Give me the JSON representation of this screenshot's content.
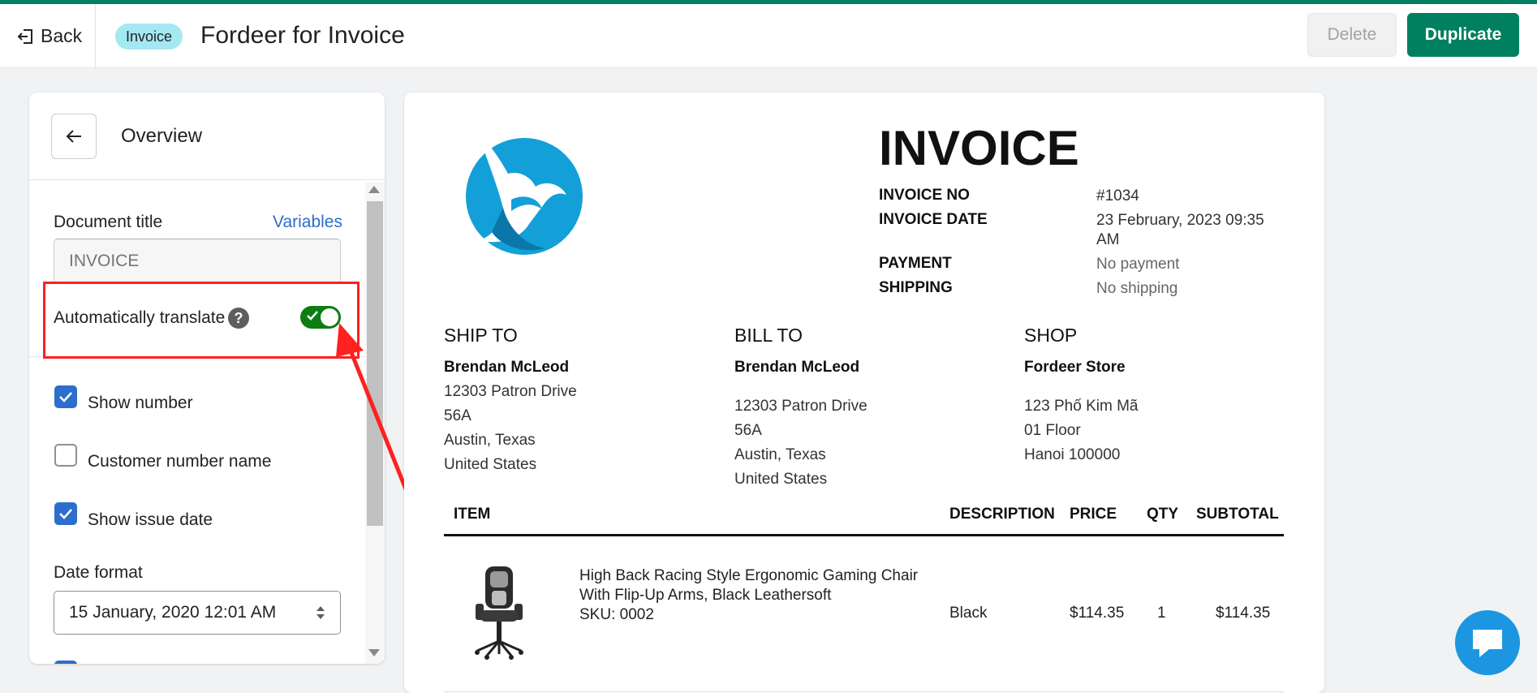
{
  "header": {
    "back_label": "Back",
    "badge": "Invoice",
    "title": "Fordeer for Invoice",
    "delete_label": "Delete",
    "duplicate_label": "Duplicate"
  },
  "panel": {
    "title": "Overview",
    "document_title_label": "Document title",
    "variables_link": "Variables",
    "document_title_placeholder": "INVOICE",
    "auto_translate_label": "Automatically translate",
    "auto_translate_on": true,
    "options": [
      {
        "label": "Show number",
        "checked": true
      },
      {
        "label": "Customer number name",
        "checked": false
      },
      {
        "label": "Show issue date",
        "checked": true
      }
    ],
    "date_format_label": "Date format",
    "date_format_value": "15 January, 2020 12:01 AM"
  },
  "invoice": {
    "heading": "INVOICE",
    "meta": {
      "invoice_no_key": "INVOICE NO",
      "invoice_no_val": "#1034",
      "invoice_date_key": "INVOICE DATE",
      "invoice_date_val": "23 February, 2023 09:35 AM",
      "payment_key": "PAYMENT",
      "payment_val": "No payment",
      "shipping_key": "SHIPPING",
      "shipping_val": "No shipping"
    },
    "ship_to": {
      "heading": "SHIP TO",
      "name": "Brendan McLeod",
      "lines": [
        "12303 Patron Drive",
        "56A",
        "Austin, Texas",
        "United States"
      ]
    },
    "bill_to": {
      "heading": "BILL TO",
      "name": "Brendan McLeod",
      "lines": [
        "12303 Patron Drive",
        "56A",
        "Austin, Texas",
        "United States"
      ]
    },
    "shop": {
      "heading": "SHOP",
      "name": "Fordeer Store",
      "lines": [
        "123 Phố Kim Mã",
        "01 Floor",
        "Hanoi 100000"
      ]
    },
    "columns": {
      "item": "ITEM",
      "description": "DESCRIPTION",
      "price": "PRICE",
      "qty": "QTY",
      "subtotal": "SUBTOTAL"
    },
    "items": [
      {
        "name_line1": "High Back Racing Style Ergonomic Gaming Chair",
        "name_line2": "With Flip-Up Arms, Black Leathersoft",
        "sku": "SKU: 0002",
        "description": "Black",
        "price": "$114.35",
        "qty": "1",
        "subtotal": "$114.35"
      }
    ]
  },
  "colors": {
    "brand_green": "#008060",
    "annotation_red": "#ff2020",
    "toggle_green": "#0c7d12",
    "logo_blue": "#13a0d8"
  },
  "icons": {
    "back": "back-arrow-icon",
    "help": "question-icon",
    "chat": "chat-icon"
  }
}
